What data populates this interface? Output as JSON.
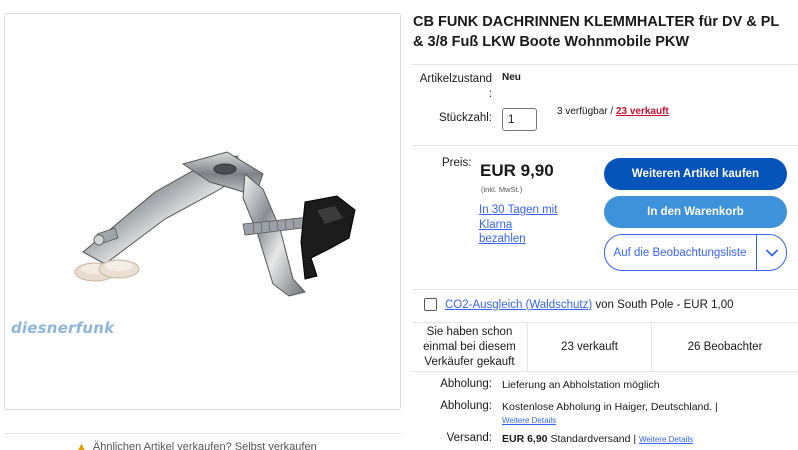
{
  "image": {
    "watermark": "diesnerfunk"
  },
  "below_image": {
    "text": "Ähnlichen Artikel verkaufen? Selbst verkaufen"
  },
  "product": {
    "title": "CB FUNK DACHRINNEN KLEMMHALTER für DV & PL & 3/8 Fuß LKW Boote Wohnmobile PKW"
  },
  "condition": {
    "label_line1": "Artikelzustand",
    "label_line2": ":",
    "value": "Neu"
  },
  "quantity": {
    "label": "Stückzahl:",
    "value": "1",
    "available": "3 verfügbar /",
    "sold": "23 verkauft"
  },
  "price": {
    "label": "Preis:",
    "amount": "EUR 9,90",
    "vat": "(inkl. MwSt.)",
    "klarna": "In 30 Tagen mit Klarna bezahlen"
  },
  "buttons": {
    "buy": "Weiteren Artikel kaufen",
    "cart": "In den Warenkorb",
    "watch": "Auf die Beobachtungsliste"
  },
  "co2": {
    "link": "CO2-Ausgleich (Waldschutz)",
    "rest": " von South Pole - EUR 1,00"
  },
  "stats": {
    "previous_purchase": "Sie haben schon einmal bei diesem Verkäufer gekauft",
    "sold": "23 verkauft",
    "watchers": "26 Beobachter"
  },
  "shipping": {
    "pickup1_label": "Abholung:",
    "pickup1_value": "Lieferung an Abholstation möglich",
    "pickup2_label": "Abholung:",
    "pickup2_value": "Kostenlose Abholung in Haiger, Deutschland. |",
    "pickup2_link": "Weitere Details",
    "shipping_label": "Versand:",
    "shipping_amount": "EUR 6,90",
    "shipping_method": " Standardversand |",
    "shipping_link": "Weitere Details"
  },
  "colors": {
    "primary_button": "#0654ba",
    "secondary_button": "#3d92d9",
    "link": "#3665f3",
    "sold_red": "#c8102e",
    "watermark": "#8fb6d8"
  },
  "icons": {
    "watch_dropdown": "chevron-down-icon",
    "product_photo": "gutter-clamp-mount-image"
  }
}
